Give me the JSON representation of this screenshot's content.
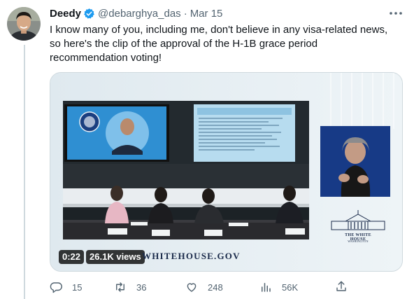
{
  "author": {
    "name": "Deedy",
    "handle": "@debarghya_das",
    "separator": "·",
    "date": "Mar 15",
    "verified": true
  },
  "tweet": {
    "lines": [
      "I know many of you, including me, don't believe in any visa-related news,",
      "so here's the clip of the approval of the H-1B grace period",
      "recommendation voting!"
    ]
  },
  "media": {
    "duration": "0:22",
    "views": "26.1K views",
    "watermark_url": "WHITEHOUSE.GOV",
    "logo_text": "THE WHITE HOUSE",
    "logo_subtext": "WASHINGTON"
  },
  "actions": {
    "replies": "15",
    "retweets": "36",
    "likes": "248",
    "views": "56K"
  },
  "icons": {
    "verified": "verified-badge-icon",
    "more": "more-options-icon",
    "reply": "reply-icon",
    "retweet": "retweet-icon",
    "like": "heart-icon",
    "views": "views-chart-icon",
    "share": "share-icon"
  },
  "colors": {
    "verified_blue": "#1d9bf0",
    "secondary_text": "#536471",
    "primary_text": "#0f1419"
  }
}
